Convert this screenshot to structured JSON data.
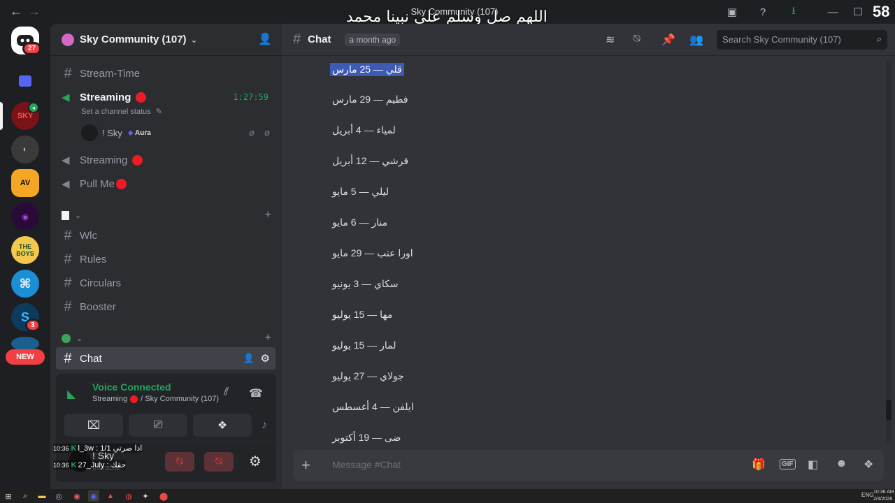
{
  "window": {
    "title": "Sky Community (107)",
    "overlay_text": "اللهم صل وسلم على نبينا محمد",
    "corner_counter": "58"
  },
  "rail": {
    "dm_badge": "27",
    "server_badge_s": "3",
    "new_label": "NEW"
  },
  "server": {
    "name": "Sky Community (107)"
  },
  "sidebar": {
    "channels_top": [
      {
        "label": "Stream-Time"
      }
    ],
    "streaming_active": {
      "label": "Streaming",
      "timer": "1:27:59",
      "status_placeholder": "Set a channel status",
      "member_name": "! Sky",
      "member_tag": "Aura"
    },
    "voice_channels": [
      {
        "label": "Streaming"
      },
      {
        "label": "Pull Me"
      }
    ],
    "text_channels": [
      {
        "label": "Wlc"
      },
      {
        "label": "Rules"
      },
      {
        "label": "Circulars"
      },
      {
        "label": "Booster"
      }
    ],
    "selected_channel": "Chat"
  },
  "voice_panel": {
    "status": "Voice Connected",
    "channel": "Streaming",
    "server": "/ Sky Community (107)"
  },
  "user_panel": {
    "username": "! Sky",
    "status": "Invisible",
    "overlay_line1": "l_3w : اذا صرتي 1/1",
    "overlay_line2": "27_July : حقك",
    "time1": "10:36",
    "time2": "10:36"
  },
  "chat": {
    "channel_name": "Chat",
    "timestamp_pill": "a month ago",
    "search_placeholder": "Search Sky Community (107)",
    "composer_placeholder": "Message #Chat",
    "messages": [
      "قلي — 25 مارس",
      "فطيم — 29 مارس",
      "لمياء — 4 أبريل",
      "قرشي — 12 أبريل",
      "ليلي — 5 مايو",
      "منار — 6 مايو",
      "اورا عتب — 29 مايو",
      "سكاي — 3 يونيو",
      "مها — 15 يوليو",
      "لمار — 15 يوليو",
      "جولاي — 27 يوليو",
      "ايلفن — 4 أغسطس",
      "ضى — 19 أكتوبر"
    ]
  },
  "taskbar": {
    "lang": "ENG",
    "time": "10:36 AM",
    "date": "2/4/2026"
  }
}
